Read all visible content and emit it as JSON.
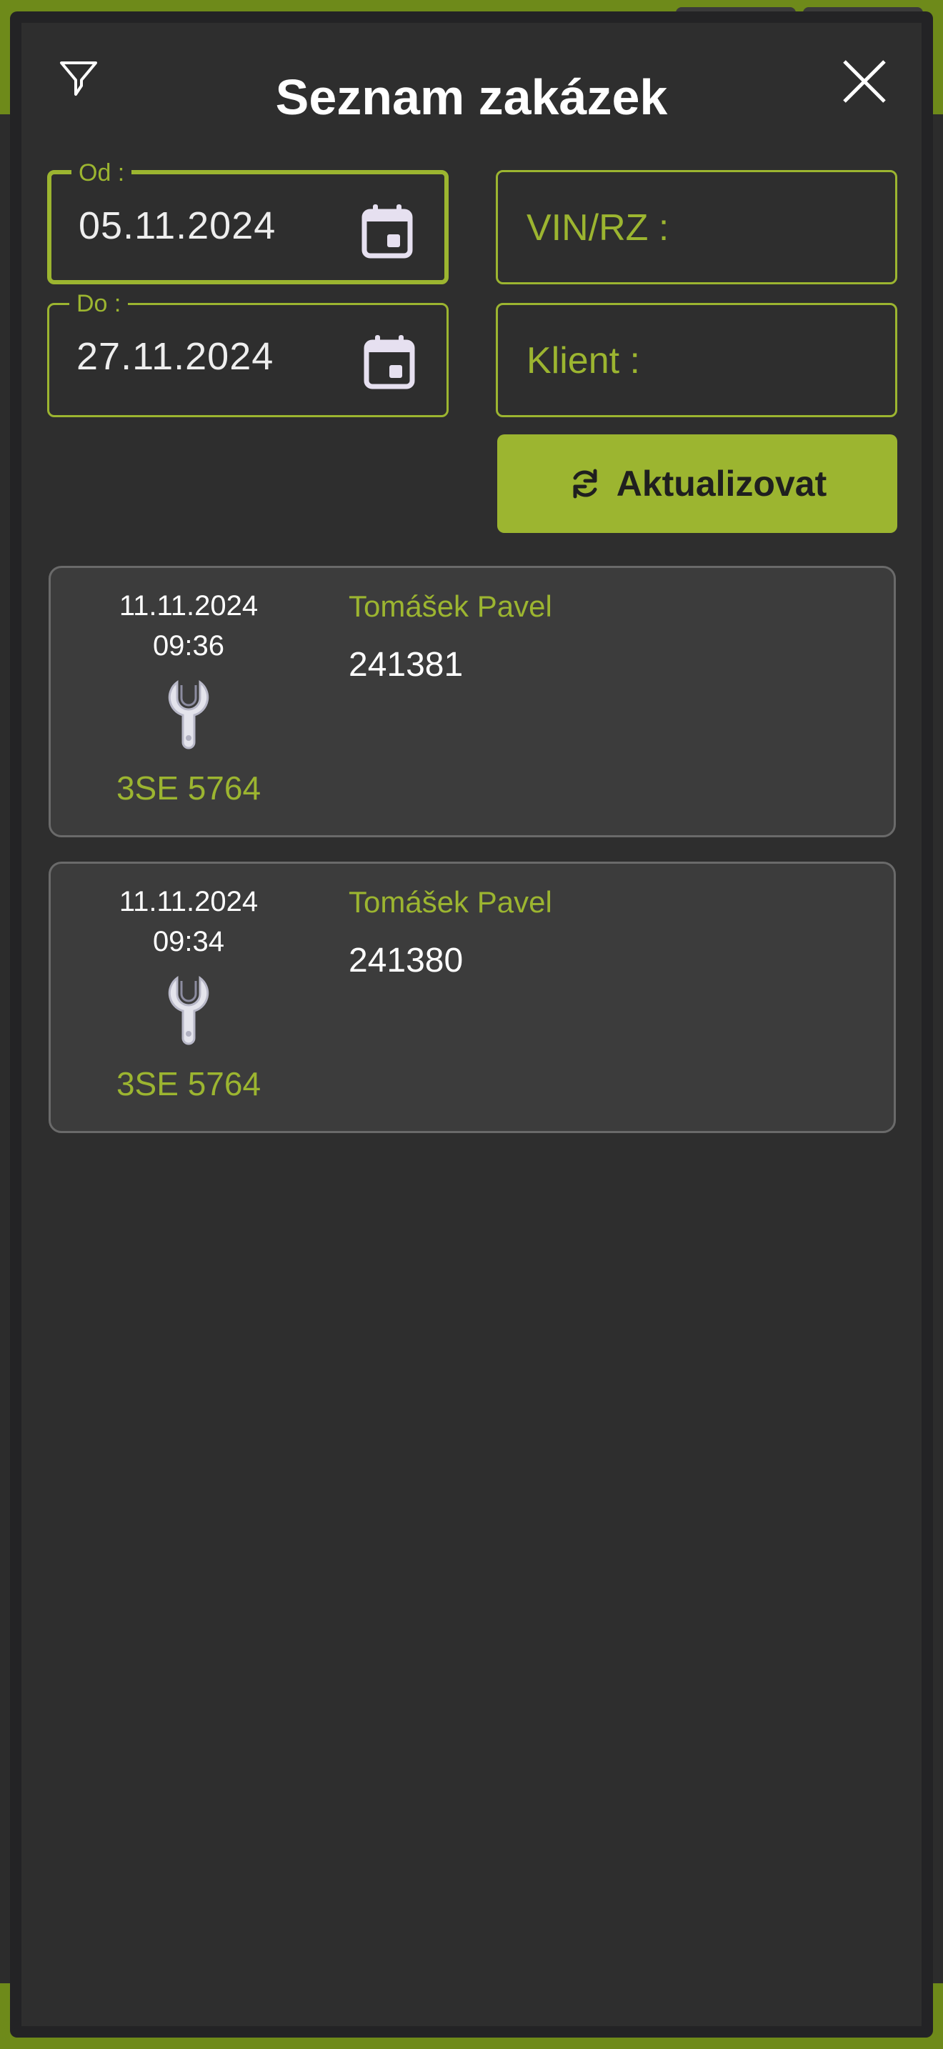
{
  "header": {
    "title": "Seznam zakázek",
    "filter_icon": "filter-icon",
    "close_icon": "close-icon"
  },
  "filters": {
    "from": {
      "label": "Od :",
      "value": "05.11.2024",
      "icon": "calendar-icon"
    },
    "to": {
      "label": "Do :",
      "value": "27.11.2024",
      "icon": "calendar-icon"
    },
    "vin": {
      "placeholder": "VIN/RZ :"
    },
    "client": {
      "placeholder": "Klient :"
    },
    "refresh_button": {
      "label": "Aktualizovat",
      "icon": "refresh-icon"
    }
  },
  "orders": [
    {
      "date": "11.11.2024",
      "time": "09:36",
      "icon": "wrench-icon",
      "plate": "3SE 5764",
      "client": "Tomášek Pavel",
      "number": "241381"
    },
    {
      "date": "11.11.2024",
      "time": "09:34",
      "icon": "wrench-icon",
      "plate": "3SE 5764",
      "client": "Tomášek Pavel",
      "number": "241380"
    }
  ],
  "colors": {
    "accent": "#9cb530",
    "background": "#2e2e2e",
    "card": "#3c3c3c",
    "band": "#6e8a1a"
  }
}
